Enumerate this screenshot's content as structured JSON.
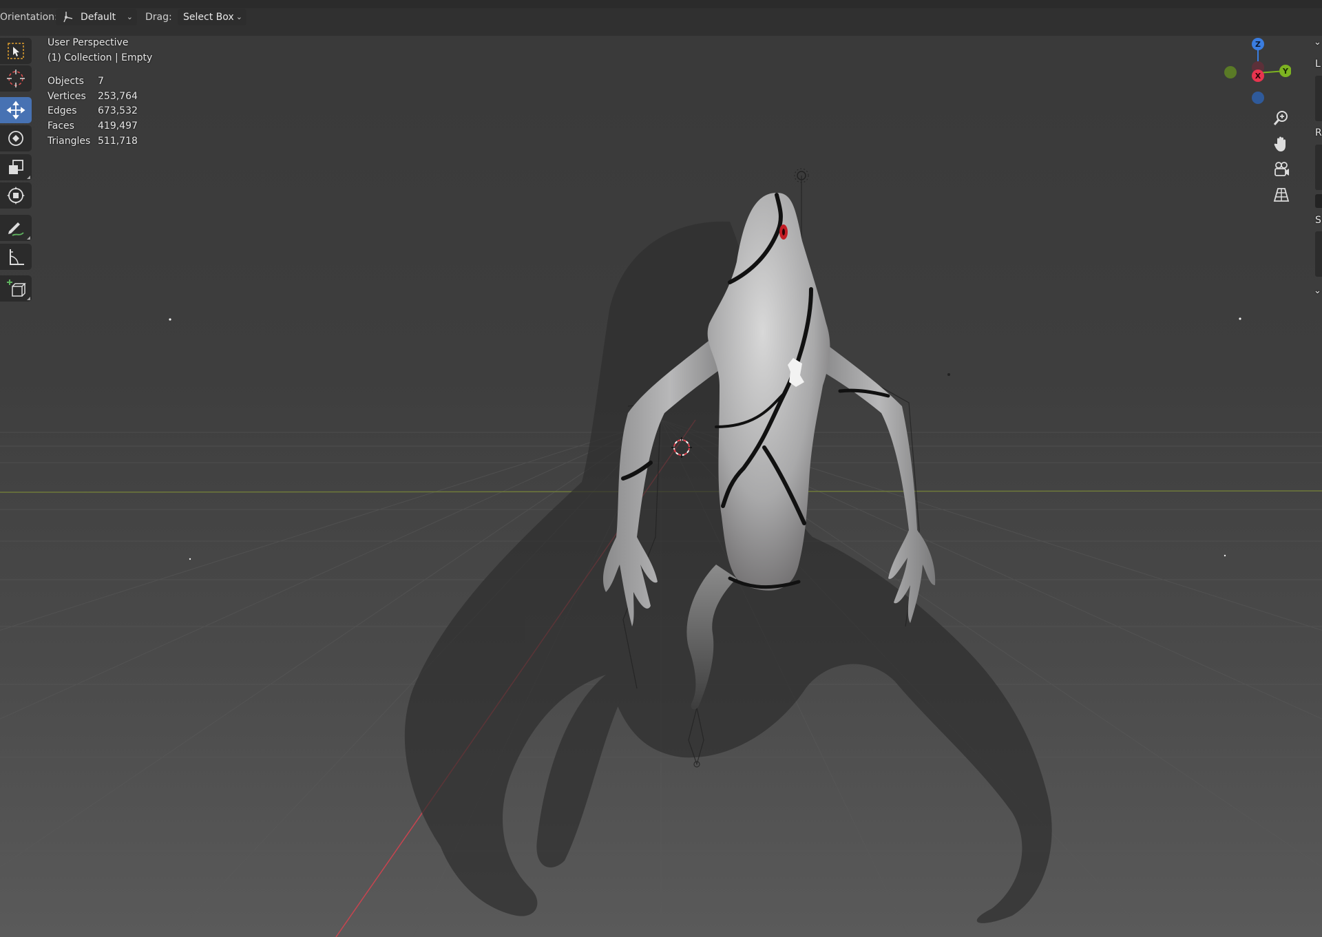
{
  "header": {
    "orientation_label": "Orientation:",
    "orientation_value": "Default",
    "drag_label": "Drag:",
    "drag_value": "Select Box"
  },
  "toolbar": {
    "tools": [
      {
        "name": "select-box-tool",
        "icon": "select-box-icon",
        "active": false
      },
      {
        "name": "cursor-tool",
        "icon": "cursor-icon",
        "active": false
      },
      {
        "name": "move-tool",
        "icon": "move-icon",
        "active": true
      },
      {
        "name": "rotate-tool",
        "icon": "rotate-icon",
        "active": false
      },
      {
        "name": "scale-tool",
        "icon": "scale-icon",
        "active": false
      },
      {
        "name": "transform-tool",
        "icon": "transform-icon",
        "active": false
      },
      {
        "name": "annotate-tool",
        "icon": "annotate-icon",
        "active": false
      },
      {
        "name": "measure-tool",
        "icon": "measure-icon",
        "active": false
      },
      {
        "name": "add-cube-tool",
        "icon": "add-cube-icon",
        "active": false
      }
    ]
  },
  "overlay": {
    "view_name": "User Perspective",
    "collection_info": "(1) Collection | Empty",
    "stats": [
      {
        "label": "Objects",
        "value": "7"
      },
      {
        "label": "Vertices",
        "value": "253,764"
      },
      {
        "label": "Edges",
        "value": "673,532"
      },
      {
        "label": "Faces",
        "value": "419,497"
      },
      {
        "label": "Triangles",
        "value": "511,718"
      }
    ]
  },
  "gizmo": {
    "axes": [
      {
        "label": "Z",
        "color": "#3a7de0"
      },
      {
        "label": "Y",
        "color": "#7db321"
      },
      {
        "label": "X",
        "color": "#e8344f"
      }
    ],
    "nav_buttons": [
      "zoom-icon",
      "hand-icon",
      "camera-icon",
      "grid-icon"
    ]
  },
  "sidebar": {
    "labels": [
      "L",
      "R",
      "S"
    ]
  },
  "colors": {
    "active_tool": "#4772b3",
    "x_axis": "#c8444f",
    "y_axis_floor": "#6f7a3a"
  }
}
